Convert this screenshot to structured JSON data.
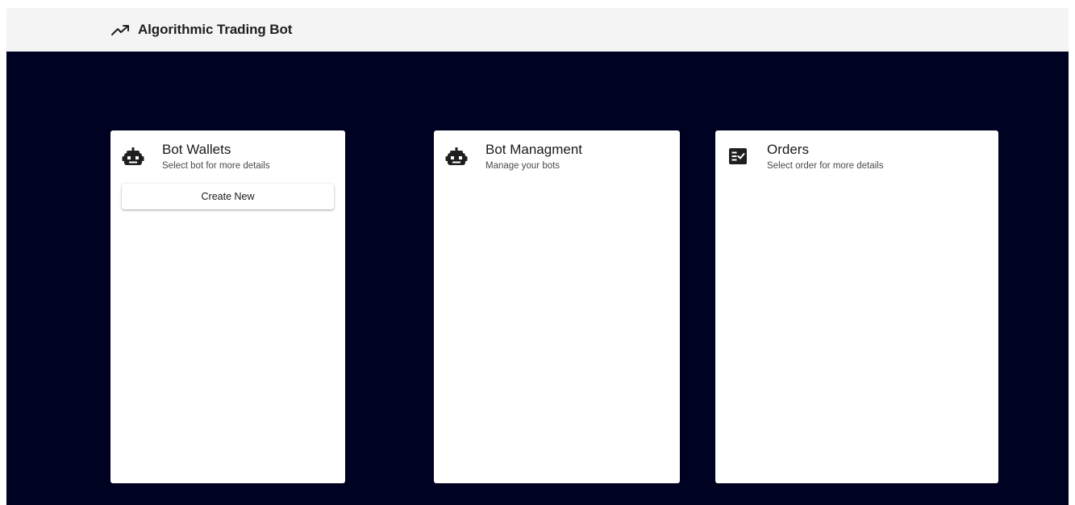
{
  "app": {
    "title": "Algorithmic Trading Bot",
    "logo_icon": "trending-up-icon",
    "colors": {
      "appbar_bg": "#f4f4f4",
      "page_bg": "#000222",
      "card_bg": "#ffffff",
      "icon": "#1f1f1f"
    }
  },
  "cards": {
    "wallets": {
      "icon": "robot-icon",
      "title": "Bot Wallets",
      "subtitle": "Select bot for more details",
      "create_label": "Create New"
    },
    "management": {
      "icon": "robot-icon",
      "title": "Bot Managment",
      "subtitle": "Manage your bots"
    },
    "orders": {
      "icon": "checklist-icon",
      "title": "Orders",
      "subtitle": "Select order for more details"
    }
  }
}
